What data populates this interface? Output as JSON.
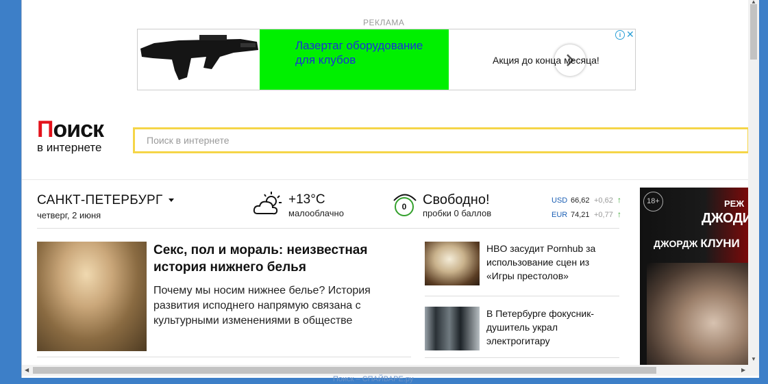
{
  "ad": {
    "label": "РЕКЛАМА",
    "headline": "Лазертаг оборудование для клубов",
    "side_text": "Акция до конца месяца!",
    "info": "i",
    "close": "✕",
    "green": "#00f000"
  },
  "logo": {
    "first": "П",
    "rest": "оиск",
    "sub": "в интернете"
  },
  "search": {
    "placeholder": "Поиск в интернете",
    "value": ""
  },
  "city": {
    "name": "САНКТ-ПЕТЕРБУРГ",
    "date": "четверг, 2 июня"
  },
  "weather": {
    "icon": "cloud-sun-icon",
    "temp": "+13°C",
    "desc": "малооблачно"
  },
  "traffic": {
    "score": "0",
    "title": "Свободно!",
    "sub": "пробки 0 баллов"
  },
  "rates": [
    {
      "cur": "USD",
      "val": "66,62",
      "chg": "+0,62",
      "dir": "↑"
    },
    {
      "cur": "EUR",
      "val": "74,21",
      "chg": "+0,77",
      "dir": "↑"
    }
  ],
  "main_article": {
    "title": "Секс, пол и мораль: неизвестная история нижнего белья",
    "lead": "Почему мы носим нижнее белье? История развития исподнего напрямую связана с культурными изменениями в обществе"
  },
  "news": [
    {
      "text": "HBO засудит Pornhub за использование сцен из «Игры престолов»"
    },
    {
      "text": "В Петербурге фокусник-душитель украл электрогитару"
    }
  ],
  "side_ad": {
    "badge": "18+",
    "line0": "РЕЖ",
    "line1": "ДЖОДИ",
    "line2_small": "ДЖОРДЖ",
    "line2_big": "КЛУНИ"
  },
  "watermark": "Поиск – СПАЙВАРЕ.ру"
}
